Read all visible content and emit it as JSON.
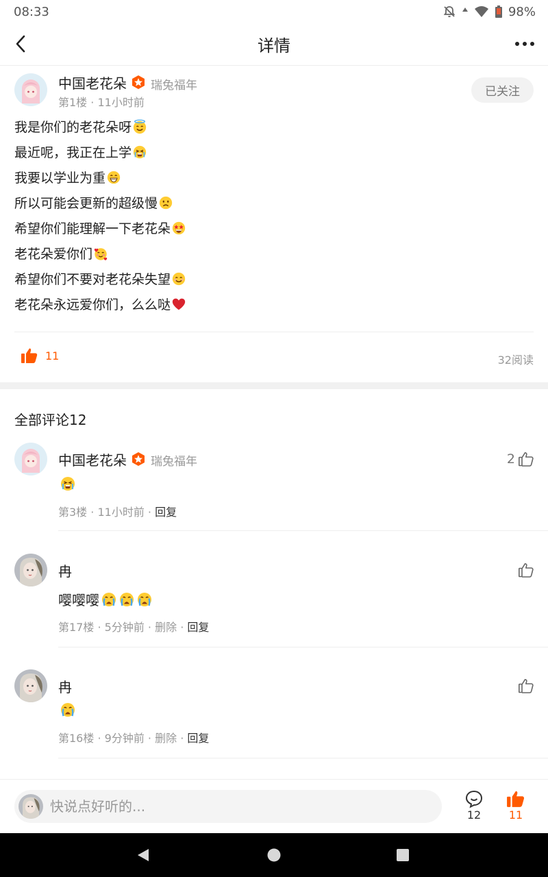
{
  "status": {
    "time": "08:33",
    "battery": "98%"
  },
  "nav": {
    "title": "详情"
  },
  "post": {
    "author": "中国老花朵",
    "badge": "瑞兔福年",
    "floor": "第1楼",
    "time": "11小时前",
    "follow_label": "已关注",
    "lines": [
      {
        "text": "我是你们的老花朵呀",
        "emoji": "innocent-smile"
      },
      {
        "text": "最近呢，我正在上学",
        "emoji": "crying-loud"
      },
      {
        "text": "我要以学业为重",
        "emoji": "grin"
      },
      {
        "text": "所以可能会更新的超级慢",
        "emoji": "frown"
      },
      {
        "text": "希望你们能理解一下老花朵",
        "emoji": "star-eyes"
      },
      {
        "text": "老花朵爱你们",
        "emoji": "hearts-face"
      },
      {
        "text": "希望你们不要对老花朵失望",
        "emoji": "smile"
      },
      {
        "text": "老花朵永远爱你们，么么哒",
        "emoji": "red-heart"
      }
    ],
    "likes": "11",
    "reads": "32阅读"
  },
  "comments_header": "全部评论12",
  "comments": [
    {
      "author": "中国老花朵",
      "badge": "瑞兔福年",
      "text": "",
      "emojis": [
        "crying-loud"
      ],
      "floor": "第3楼",
      "time": "11小时前",
      "delete_label": "",
      "reply_label": "回复",
      "likes": "2"
    },
    {
      "author": "冉",
      "badge": "",
      "text": "嘤嘤嘤",
      "emojis": [
        "crying",
        "crying",
        "crying"
      ],
      "floor": "第17楼",
      "time": "5分钟前",
      "delete_label": "删除",
      "reply_label": "回复",
      "likes": ""
    },
    {
      "author": "冉",
      "badge": "",
      "text": "",
      "emojis": [
        "crying"
      ],
      "floor": "第16楼",
      "time": "9分钟前",
      "delete_label": "删除",
      "reply_label": "回复",
      "likes": ""
    }
  ],
  "bottom": {
    "input_placeholder": "快说点好听的...",
    "comment_count": "12",
    "like_count": "11"
  },
  "colors": {
    "accent": "#ff5a00",
    "muted": "#999999",
    "divider": "#eeeeee"
  }
}
